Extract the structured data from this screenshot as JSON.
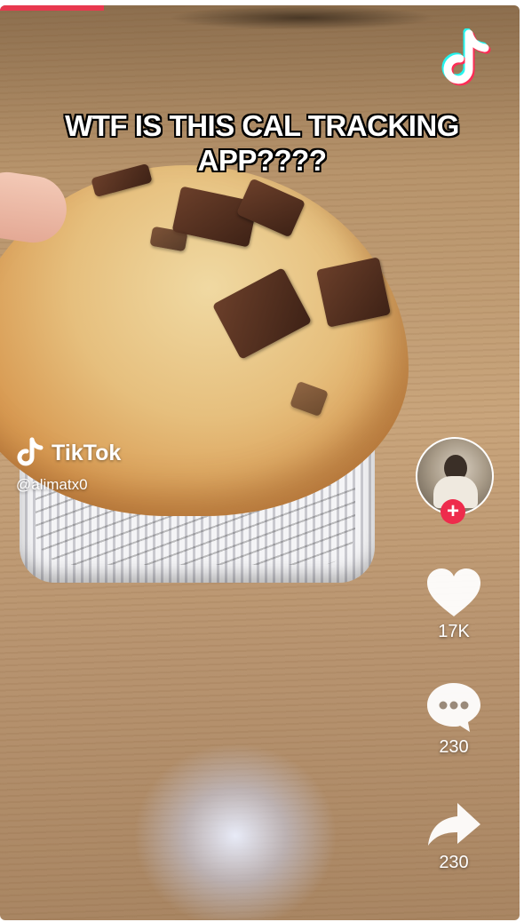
{
  "video": {
    "caption": "WTF IS THIS CAL TRACKING APP????",
    "progress_fraction": 0.2
  },
  "watermark": {
    "brand": "TikTok",
    "handle": "@alimatx0",
    "icon": "tiktok-note-icon"
  },
  "corner_logo": {
    "icon": "tiktok-logo-icon"
  },
  "sidebar": {
    "avatar_icon": "creator-avatar",
    "follow_label": "+",
    "like_count": "17K",
    "comment_count": "230",
    "share_count": "230",
    "like_icon": "heart-icon",
    "comment_icon": "comment-bubble-icon",
    "share_icon": "share-arrow-icon"
  },
  "colors": {
    "progress": "#e8384f",
    "follow_badge": "#ee2b4c",
    "tiktok_cyan": "#25f4ee",
    "tiktok_red": "#fe2c55"
  }
}
